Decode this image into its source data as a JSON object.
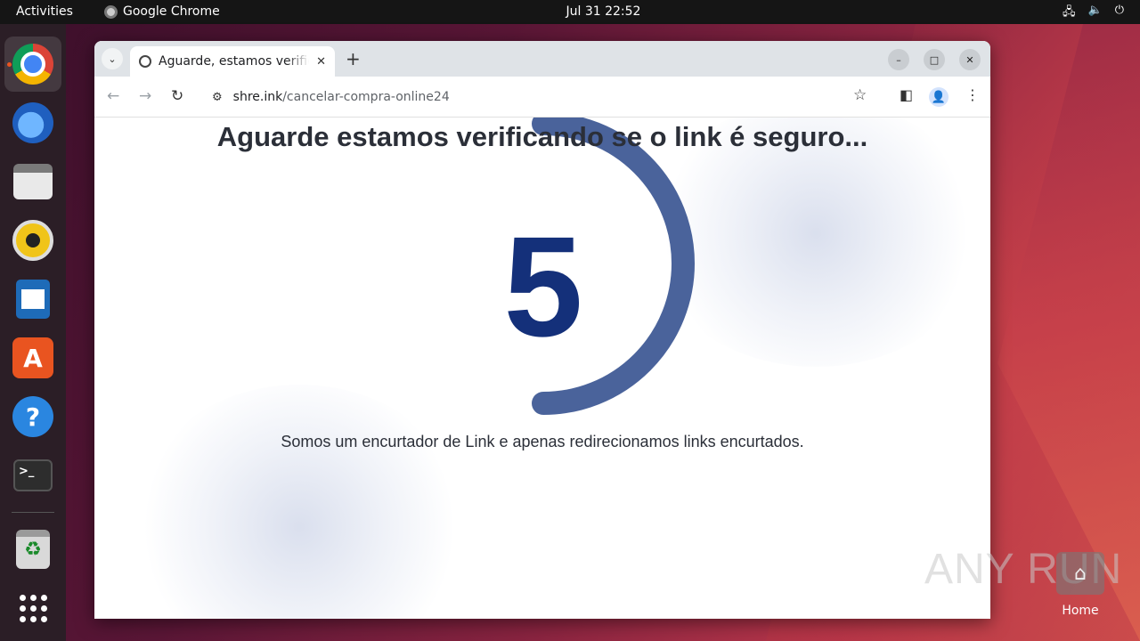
{
  "topbar": {
    "activities": "Activities",
    "app_name": "Google Chrome",
    "clock": "Jul 31  22:52",
    "tray_icons": [
      "network-icon",
      "volume-icon",
      "power-icon"
    ]
  },
  "dock": {
    "items": [
      "chrome",
      "thunderbird",
      "files",
      "rhythmbox",
      "libreoffice-writer",
      "app-center",
      "help",
      "terminal",
      "trash",
      "show-apps"
    ]
  },
  "browser": {
    "tab_title": "Aguarde, estamos verificando",
    "new_tab": "+",
    "url_host": "shre.ink",
    "url_path": "/cancelar-compra-online24"
  },
  "page": {
    "heading": "Aguarde estamos verificando se o link é seguro...",
    "countdown": "5",
    "subtext": "Somos um encurtador de Link e apenas redirecionamos links encurtados.",
    "progress_fraction": 0.5,
    "accent_color": "#4a639b",
    "number_color": "#14307a"
  },
  "desktop": {
    "watermark": "ANY RUN",
    "home_label": "Home"
  }
}
